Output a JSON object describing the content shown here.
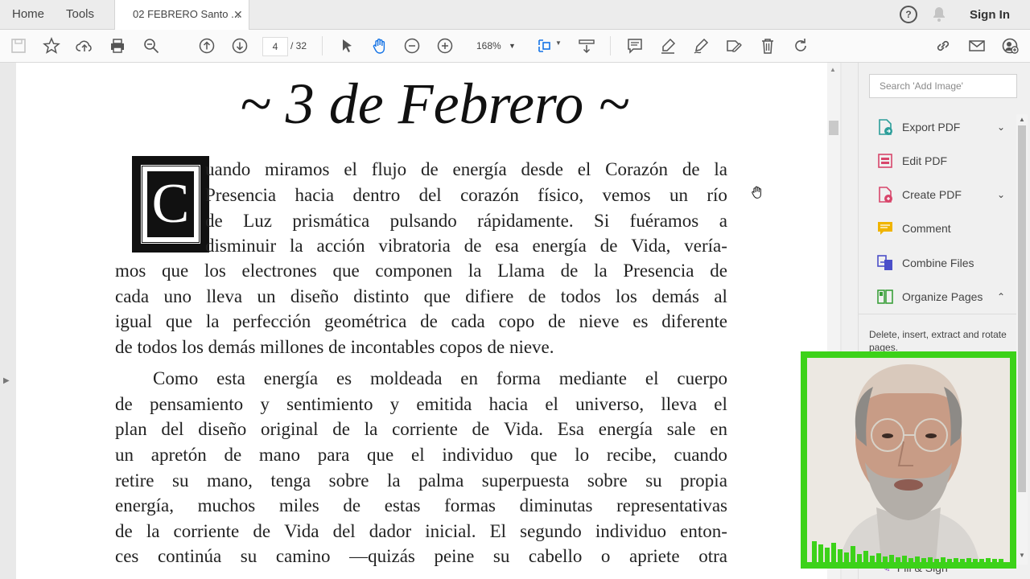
{
  "topbar": {
    "home": "Home",
    "tools": "Tools",
    "doc_tab": "02 FEBRERO Santo ...",
    "close": "✕",
    "help": "?",
    "sign_in": "Sign In"
  },
  "toolbar": {
    "page_current": "4",
    "page_sep_total": "/  32",
    "zoom": "168%"
  },
  "document": {
    "heading": "~ 3 de Febrero ~",
    "drop_cap": "C",
    "lines": [
      [
        "uando",
        "miramos",
        "el",
        "flujo",
        "de",
        "energía",
        "desde",
        "el",
        "Corazón",
        "de",
        "la"
      ],
      [
        "Presencia",
        "hacia",
        "dentro",
        "del",
        "corazón",
        "físico,",
        "vemos",
        "un",
        "río"
      ],
      [
        "de",
        "Luz",
        "prismática",
        "pulsando",
        "rápidamente.",
        "Si",
        "fuéramos",
        "a"
      ],
      [
        "disminuir",
        "la",
        "acción",
        "vibratoria",
        "de",
        "esa",
        "energía",
        "de",
        "Vida,",
        "vería-"
      ],
      [
        "mos",
        "que",
        "los",
        "electrones",
        "que",
        "componen",
        "la",
        "Llama",
        "de",
        "la",
        "Presencia",
        "de"
      ],
      [
        "cada",
        "uno",
        "lleva",
        "un",
        "diseño",
        "distinto",
        "que",
        "difiere",
        "de",
        "todos",
        "los",
        "demás",
        "al"
      ],
      [
        "igual",
        "que",
        "la",
        "perfección",
        "geométrica",
        "de",
        "cada",
        "copo",
        "de",
        "nieve",
        "es",
        "diferente"
      ],
      [
        "de todos los demás millones de incontables copos de nieve."
      ],
      [
        "Como",
        "esta",
        "energía",
        "es",
        "moldeada",
        "en",
        "forma",
        "mediante",
        "el",
        "cuerpo"
      ],
      [
        "de",
        "pensamiento",
        "y",
        "sentimiento",
        "y",
        "emitida",
        "hacia",
        "el",
        "universo,",
        "lleva",
        "el"
      ],
      [
        "plan",
        "del",
        "diseño",
        "original",
        "de",
        "la",
        "corriente",
        "de",
        "Vida.",
        "Esa",
        "energía",
        "sale",
        "en"
      ],
      [
        "un",
        "apretón",
        "de",
        "mano",
        "para",
        "que",
        "el",
        "individuo",
        "que",
        "lo",
        "recibe,",
        "cuando"
      ],
      [
        "retire",
        "su",
        "mano,",
        "tenga",
        "sobre",
        "la",
        "palma",
        "superpuesta",
        "sobre",
        "su",
        "propia"
      ],
      [
        "energía,",
        "muchos",
        "miles",
        "de",
        "estas",
        "formas",
        "diminutas",
        "representativas"
      ],
      [
        "de",
        "la",
        "corriente",
        "de",
        "Vida",
        "del",
        "dador",
        "inicial.",
        "El",
        "segundo",
        "individuo",
        "enton-"
      ],
      [
        "ces",
        "continúa",
        "su",
        "camino",
        "—quizás",
        "peine",
        "su",
        "cabello",
        "o",
        "apriete",
        "otra"
      ]
    ]
  },
  "right_panel": {
    "search_placeholder": "Search 'Add Image'",
    "tools": [
      {
        "label": "Export PDF",
        "color": "#2c9e9a"
      },
      {
        "label": "Edit PDF",
        "color": "#d8466b"
      },
      {
        "label": "Create PDF",
        "color": "#d8466b"
      },
      {
        "label": "Comment",
        "color": "#f0b400"
      },
      {
        "label": "Combine Files",
        "color": "#4b4fc9"
      },
      {
        "label": "Organize Pages",
        "color": "#3aa03a"
      }
    ],
    "organize_desc": "Delete, insert, extract and rotate pages.",
    "fill_sign": "Fill & Sign"
  },
  "colors": {
    "webcam_border": "#3cd219"
  }
}
